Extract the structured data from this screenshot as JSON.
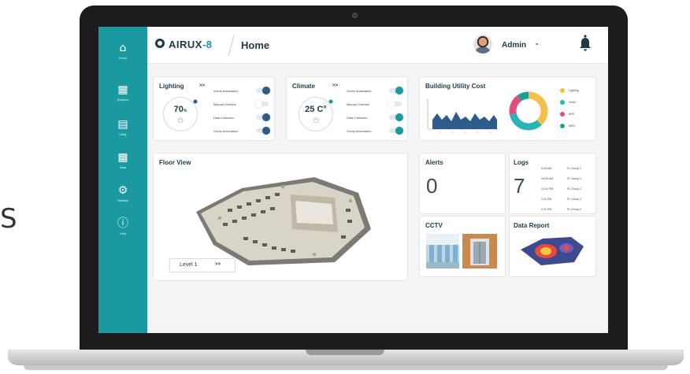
{
  "stray_glyph": "S",
  "colors": {
    "teal": "#1a9aa0",
    "navy": "#1f3a44",
    "lighting": "#f2c04a",
    "hvac": "#2ab3b7",
    "aep": "#e14b7d",
    "misc": "#1e9e9a",
    "toggle_on": "#2d5b8a"
  },
  "app": {
    "logo_prefix": "AIRUX",
    "logo_suffix": "-8",
    "page_title": "Home",
    "user": "Admin"
  },
  "sidebar": {
    "items": [
      {
        "icon": "home-icon",
        "label": "Home"
      },
      {
        "icon": "systems-icon",
        "label": "Systems"
      },
      {
        "icon": "utility-icon",
        "label": "Utility"
      },
      {
        "icon": "data-icon",
        "label": "Data"
      },
      {
        "icon": "settings-icon",
        "label": "Settings"
      },
      {
        "icon": "help-icon",
        "label": "Help"
      }
    ]
  },
  "lighting": {
    "title": "Lighting",
    "chevrons": ">>",
    "value": "70",
    "unit": "%",
    "controls": [
      {
        "label": "Scene Automation",
        "on": true
      },
      {
        "label": "Manual Override",
        "on": false
      },
      {
        "label": "Data Collection",
        "on": true
      },
      {
        "label": "Group Automation",
        "on": true
      }
    ]
  },
  "climate": {
    "title": "Climate",
    "chevrons": ">>",
    "value": "25 C°",
    "controls": [
      {
        "label": "Scene Automation",
        "on": true
      },
      {
        "label": "Manual Override",
        "on": false
      },
      {
        "label": "Data Collection",
        "on": true
      },
      {
        "label": "Group Automation",
        "on": true
      }
    ]
  },
  "utility": {
    "title": "Building Utility Cost",
    "legend": [
      {
        "label": "Lighting",
        "color": "#f2c04a"
      },
      {
        "label": "HVAC",
        "color": "#2ab3b7"
      },
      {
        "label": "AEP",
        "color": "#e14b7d"
      },
      {
        "label": "MISC",
        "color": "#1e9e9a"
      }
    ],
    "donut_shares": [
      0.38,
      0.34,
      0.18,
      0.1
    ]
  },
  "floor": {
    "title": "Floor View",
    "level": "Level 1",
    "chevrons": ">>"
  },
  "alerts": {
    "title": "Alerts",
    "count": "0"
  },
  "logs": {
    "title": "Logs",
    "count": "7",
    "entries": [
      {
        "time": "5:15 AM",
        "group": "FL Group 2"
      },
      {
        "time": "10:00 AM",
        "group": "FL Group 1"
      },
      {
        "time": "12:22 PM",
        "group": "FL Group 1"
      },
      {
        "time": "1:41 PM",
        "group": "FL Group 3"
      },
      {
        "time": "3:31 PM",
        "group": "FL Group 2"
      }
    ]
  },
  "cctv": {
    "title": "CCTV"
  },
  "report": {
    "title": "Data Report"
  }
}
